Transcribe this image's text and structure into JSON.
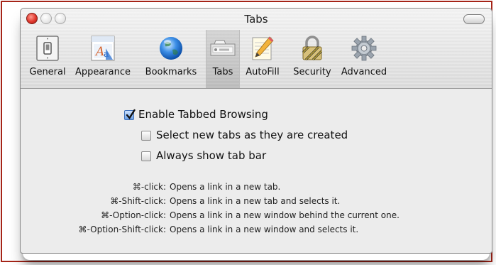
{
  "window": {
    "title": "Tabs"
  },
  "toolbar": {
    "items": [
      {
        "label": "General",
        "icon": "light-switch-icon"
      },
      {
        "label": "Appearance",
        "icon": "font-panel-icon"
      },
      {
        "label": "Bookmarks",
        "icon": "globe-icon"
      },
      {
        "label": "Tabs",
        "icon": "tab-icon",
        "selected": true
      },
      {
        "label": "AutoFill",
        "icon": "pencil-notepad-icon"
      },
      {
        "label": "Security",
        "icon": "padlock-icon"
      },
      {
        "label": "Advanced",
        "icon": "gear-icon"
      }
    ]
  },
  "options": {
    "enable_tabbed": {
      "label": "Enable Tabbed Browsing",
      "checked": true
    },
    "select_new_tabs": {
      "label": "Select new tabs as they are created",
      "checked": false
    },
    "always_show_tab_bar": {
      "label": "Always show tab bar",
      "checked": false
    }
  },
  "shortcuts": [
    {
      "key": "⌘-click:",
      "desc": "Opens a link in a new tab."
    },
    {
      "key": "⌘-Shift-click:",
      "desc": "Opens a link in a new tab and selects it."
    },
    {
      "key": "⌘-Option-click:",
      "desc": "Opens a link in a new window behind the current one."
    },
    {
      "key": "⌘-Option-Shift-click:",
      "desc": "Opens a link in a new window and selects it."
    }
  ],
  "colors": {
    "frame_border": "#a52418",
    "close_button": "#e0362c",
    "checkbox_checked": "#6aa0e8"
  }
}
